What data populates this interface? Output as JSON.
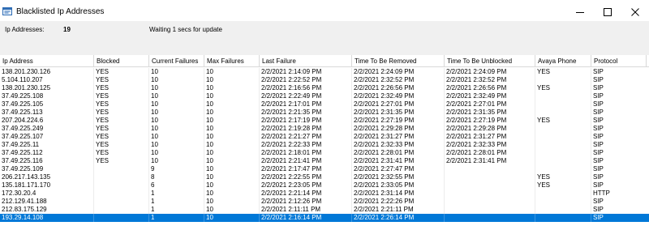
{
  "window": {
    "title": "Blacklisted Ip Addresses"
  },
  "info": {
    "count_label": "Ip Addresses:",
    "count_value": "19",
    "status_text": "Waiting 1 secs for update"
  },
  "table": {
    "columns": [
      "Ip Address",
      "Blocked",
      "Current Failures",
      "Max Failures",
      "Last Failure",
      "Time To Be Removed",
      "Time To Be Unblocked",
      "Avaya Phone",
      "Protocol"
    ],
    "rows": [
      [
        "138.201.230.126",
        "YES",
        "10",
        "10",
        "2/2/2021 2:14:09 PM",
        "2/2/2021 2:24:09 PM",
        "2/2/2021 2:24:09 PM",
        "YES",
        "SIP"
      ],
      [
        "5.104.110.207",
        "YES",
        "10",
        "10",
        "2/2/2021 2:22:52 PM",
        "2/2/2021 2:32:52 PM",
        "2/2/2021 2:32:52 PM",
        "",
        "SIP"
      ],
      [
        "138.201.230.125",
        "YES",
        "10",
        "10",
        "2/2/2021 2:16:56 PM",
        "2/2/2021 2:26:56 PM",
        "2/2/2021 2:26:56 PM",
        "YES",
        "SIP"
      ],
      [
        "37.49.225.108",
        "YES",
        "10",
        "10",
        "2/2/2021 2:22:49 PM",
        "2/2/2021 2:32:49 PM",
        "2/2/2021 2:32:49 PM",
        "",
        "SIP"
      ],
      [
        "37.49.225.105",
        "YES",
        "10",
        "10",
        "2/2/2021 2:17:01 PM",
        "2/2/2021 2:27:01 PM",
        "2/2/2021 2:27:01 PM",
        "",
        "SIP"
      ],
      [
        "37.49.225.113",
        "YES",
        "10",
        "10",
        "2/2/2021 2:21:35 PM",
        "2/2/2021 2:31:35 PM",
        "2/2/2021 2:31:35 PM",
        "",
        "SIP"
      ],
      [
        "207.204.224.6",
        "YES",
        "10",
        "10",
        "2/2/2021 2:17:19 PM",
        "2/2/2021 2:27:19 PM",
        "2/2/2021 2:27:19 PM",
        "YES",
        "SIP"
      ],
      [
        "37.49.225.249",
        "YES",
        "10",
        "10",
        "2/2/2021 2:19:28 PM",
        "2/2/2021 2:29:28 PM",
        "2/2/2021 2:29:28 PM",
        "",
        "SIP"
      ],
      [
        "37.49.225.107",
        "YES",
        "10",
        "10",
        "2/2/2021 2:21:27 PM",
        "2/2/2021 2:31:27 PM",
        "2/2/2021 2:31:27 PM",
        "",
        "SIP"
      ],
      [
        "37.49.225.11",
        "YES",
        "10",
        "10",
        "2/2/2021 2:22:33 PM",
        "2/2/2021 2:32:33 PM",
        "2/2/2021 2:32:33 PM",
        "",
        "SIP"
      ],
      [
        "37.49.225.112",
        "YES",
        "10",
        "10",
        "2/2/2021 2:18:01 PM",
        "2/2/2021 2:28:01 PM",
        "2/2/2021 2:28:01 PM",
        "",
        "SIP"
      ],
      [
        "37.49.225.116",
        "YES",
        "10",
        "10",
        "2/2/2021 2:21:41 PM",
        "2/2/2021 2:31:41 PM",
        "2/2/2021 2:31:41 PM",
        "",
        "SIP"
      ],
      [
        "37.49.225.109",
        "",
        "9",
        "10",
        "2/2/2021 2:17:47 PM",
        "2/2/2021 2:27:47 PM",
        "",
        "",
        "SIP"
      ],
      [
        "206.217.143.135",
        "",
        "8",
        "10",
        "2/2/2021 2:22:55 PM",
        "2/2/2021 2:32:55 PM",
        "",
        "YES",
        "SIP"
      ],
      [
        "135.181.171.170",
        "",
        "6",
        "10",
        "2/2/2021 2:23:05 PM",
        "2/2/2021 2:33:05 PM",
        "",
        "YES",
        "SIP"
      ],
      [
        "172.30.20.4",
        "",
        "1",
        "10",
        "2/2/2021 2:21:14 PM",
        "2/2/2021 2:31:14 PM",
        "",
        "",
        "HTTP"
      ],
      [
        "212.129.41.188",
        "",
        "1",
        "10",
        "2/2/2021 2:12:26 PM",
        "2/2/2021 2:22:26 PM",
        "",
        "",
        "SIP"
      ],
      [
        "212.83.175.129",
        "",
        "1",
        "10",
        "2/2/2021 2:11:11 PM",
        "2/2/2021 2:21:11 PM",
        "",
        "",
        "SIP"
      ],
      [
        "193.29.14.108",
        "",
        "1",
        "10",
        "2/2/2021 2:16:14 PM",
        "2/2/2021 2:26:14 PM",
        "",
        "",
        "SIP"
      ]
    ],
    "selected_row": 18
  },
  "colors": {
    "selection": "#0078d7",
    "info_background": "#f0f0f0",
    "grid_line": "#d9d9d9"
  },
  "icons": {
    "app": "app-icon",
    "minimize": "minimize-icon",
    "maximize": "maximize-icon",
    "close": "close-icon"
  }
}
